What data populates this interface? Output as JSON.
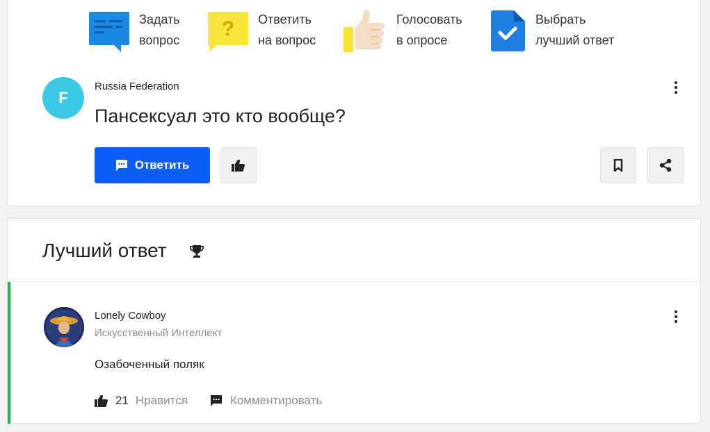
{
  "features": [
    {
      "icon": "ask-question-icon",
      "line1": "Задать",
      "line2": "вопрос"
    },
    {
      "icon": "answer-question-icon",
      "line1": "Ответить",
      "line2": "на вопрос"
    },
    {
      "icon": "thumbs-up-poll-icon",
      "line1": "Голосовать",
      "line2": "в опросе"
    },
    {
      "icon": "best-answer-check-icon",
      "line1": "Выбрать",
      "line2": "лучший ответ"
    }
  ],
  "question": {
    "avatar_letter": "F",
    "author": "Russia Federation",
    "title": "Пансексуал это кто вообще?",
    "answer_button_label": "Ответить"
  },
  "best_answer": {
    "heading": "Лучший ответ",
    "author": "Lonely Cowboy",
    "rank": "Искусственный Интеллект",
    "text": "Озабоченный поляк",
    "likes_count": "21",
    "like_label": "Нравится",
    "comment_label": "Комментировать"
  },
  "colors": {
    "primary_blue": "#0b5ff7",
    "best_answer_accent": "#27b24a",
    "avatar_cyan": "#3ec8e8"
  }
}
